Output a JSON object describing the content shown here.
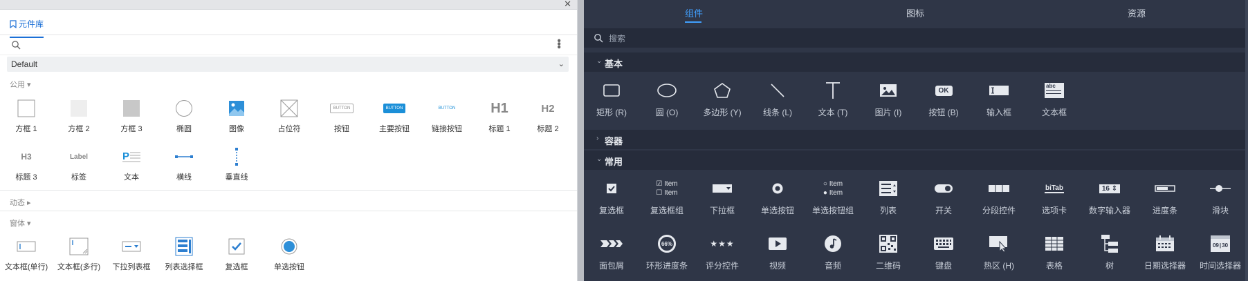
{
  "left_panel": {
    "tab_label": "元件库",
    "library_select": "Default",
    "sections": {
      "common": "公用 ▾",
      "dynamic": "动态 ▸",
      "form": "窗体 ▾"
    },
    "common_items": [
      "方框 1",
      "方框 2",
      "方框 3",
      "椭圆",
      "图像",
      "占位符",
      "按钮",
      "主要按钮",
      "链接按钮",
      "标题 1",
      "标题 2",
      "标题 3",
      "标签",
      "文本",
      "横线",
      "垂直线"
    ],
    "form_items": [
      "文本框(单行)",
      "文本框(多行)",
      "下拉列表框",
      "列表选择框",
      "复选框",
      "单选按钮"
    ],
    "icon_text": {
      "button": "BUTTON",
      "h1": "H1",
      "h2": "H2",
      "h3": "H3",
      "label": "Label"
    }
  },
  "right_panel": {
    "tabs": [
      "组件",
      "图标",
      "资源"
    ],
    "active_tab": "组件",
    "search_placeholder": "搜索",
    "sections": {
      "basic": "基本",
      "container": "容器",
      "common": "常用"
    },
    "basic_items": [
      "矩形 (R)",
      "圆 (O)",
      "多边形 (Y)",
      "线条 (L)",
      "文本 (T)",
      "图片 (I)",
      "按钮 (B)",
      "输入框",
      "文本框"
    ],
    "common_items_row1": [
      "复选框",
      "复选框组",
      "下拉框",
      "单选按钮",
      "单选按钮组",
      "列表",
      "开关",
      "分段控件",
      "选项卡",
      "数字输入器",
      "进度条",
      "滑块"
    ],
    "common_items_row2": [
      "面包屑",
      "环形进度条",
      "评分控件",
      "视频",
      "音频",
      "二维码",
      "键盘",
      "热区 (H)",
      "表格",
      "树",
      "日期选择器",
      "时间选择器"
    ],
    "icon_text": {
      "ok": "OK",
      "item": "Item",
      "bitab": "biTab",
      "num": "16",
      "progress": "66%",
      "abc": "abc",
      "time_a": "09",
      "time_b": "30"
    }
  },
  "colors": {
    "accent_left": "#1b6fd6",
    "accent_right": "#41a0ff",
    "right_bg": "#2f3647"
  }
}
